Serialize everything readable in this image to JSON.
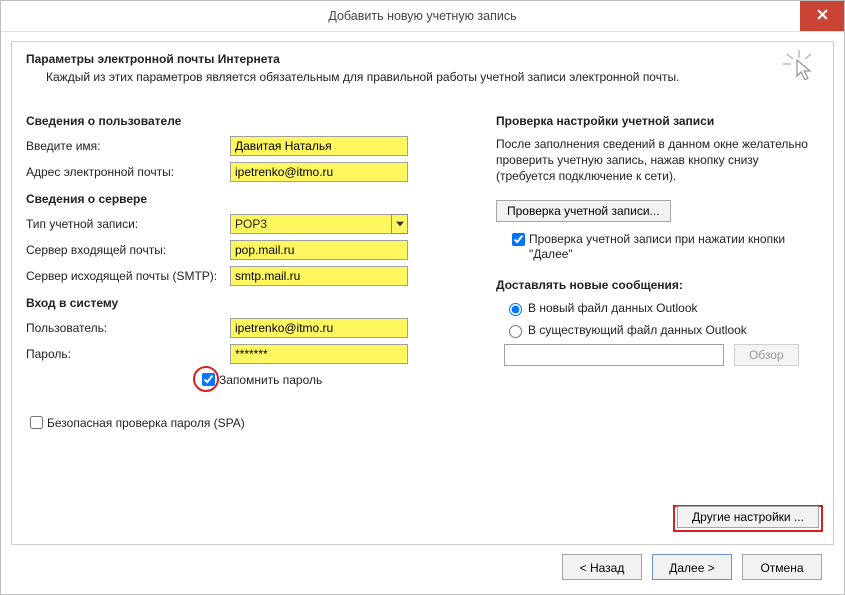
{
  "window": {
    "title": "Добавить новую учетную запись"
  },
  "header": {
    "title": "Параметры электронной почты Интернета",
    "subtitle": "Каждый из этих параметров является обязательным для правильной работы учетной записи электронной почты."
  },
  "sections": {
    "user_info": "Сведения о пользователе",
    "server_info": "Сведения о сервере",
    "login": "Вход в систему"
  },
  "labels": {
    "name": "Введите имя:",
    "email": "Адрес электронной почты:",
    "acct_type": "Тип учетной записи:",
    "incoming": "Сервер входящей почты:",
    "outgoing": "Сервер исходящей почты (SMTP):",
    "username": "Пользователь:",
    "password": "Пароль:",
    "remember": "Запомнить пароль",
    "spa": "Безопасная проверка пароля (SPA)"
  },
  "values": {
    "name": "Давитая Наталья",
    "email": "ipetrenko@itmo.ru",
    "acct_type": "POP3",
    "incoming": "pop.mail.ru",
    "outgoing": "smtp.mail.ru",
    "username": "ipetrenko@itmo.ru",
    "password": "*******"
  },
  "right": {
    "heading": "Проверка настройки учетной записи",
    "text": "После заполнения сведений в данном окне желательно проверить учетную запись, нажав кнопку снизу (требуется подключение к сети).",
    "test_btn": "Проверка учетной записи...",
    "auto_test_line1": "Проверка учетной записи при нажатии кнопки",
    "auto_test_line2": "\"Далее\"",
    "deliver_heading": "Доставлять новые сообщения:",
    "radio_new": "В новый файл данных Outlook",
    "radio_existing": "В существующий файл данных Outlook",
    "browse_value": "",
    "browse_btn": "Обзор",
    "other_btn": "Другие настройки ..."
  },
  "footer": {
    "back": "< Назад",
    "next": "Далее >",
    "cancel": "Отмена"
  }
}
